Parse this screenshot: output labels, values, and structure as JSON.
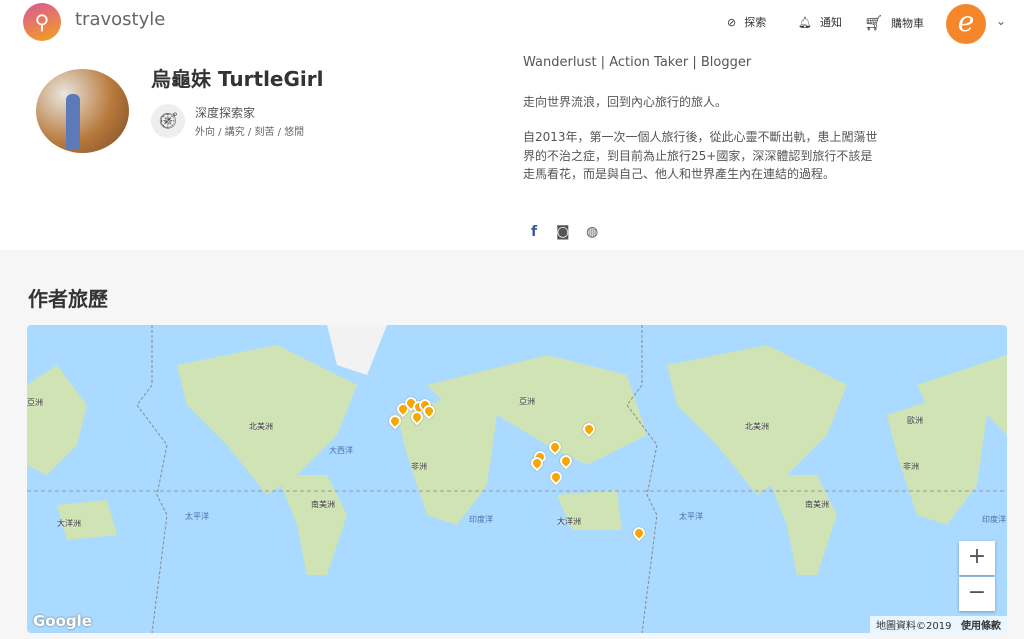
{
  "header": {
    "brand": "travostyle",
    "nav": [
      {
        "label": "探索",
        "icon": "compass-icon"
      },
      {
        "label": "通知",
        "icon": "bell-icon"
      },
      {
        "label": "購物車",
        "icon": "cart-icon"
      }
    ],
    "user_avatar_letter": "e"
  },
  "profile": {
    "name": "烏龜妹 TurtleGirl",
    "badge_title": "深度探索家",
    "badge_traits": "外向 / 講究 / 刻苦 / 悠閒",
    "tagline": "Wanderlust | Action Taker | Blogger",
    "bio_intro": "走向世界流浪，回到內心旅行的旅人。",
    "bio": "自2013年，第一次一個人旅行後，從此心靈不斷出軌，患上闖蕩世界的不治之症，到目前為止旅行25+國家，深深體認到旅行不該是走馬看花，而是與自己、他人和世界產生內在連結的過程。",
    "social": [
      "facebook-icon",
      "instagram-icon",
      "website-icon"
    ]
  },
  "section_title": "作者旅歷",
  "map": {
    "labels": [
      "亞洲",
      "北美洲",
      "大西洋",
      "非洲",
      "亞洲",
      "南美洲",
      "太平洋",
      "印度洋",
      "大洋洲",
      "大洋洲",
      "太平洋",
      "北美洲",
      "歐洲",
      "非洲",
      "南美洲",
      "印度洋"
    ],
    "google": "Google",
    "attribution": "地圖資料©2019",
    "terms": "使用條款",
    "zoom_in": "+",
    "zoom_out": "−",
    "pin_color": "#f6a800",
    "water_color": "#aadaff"
  }
}
